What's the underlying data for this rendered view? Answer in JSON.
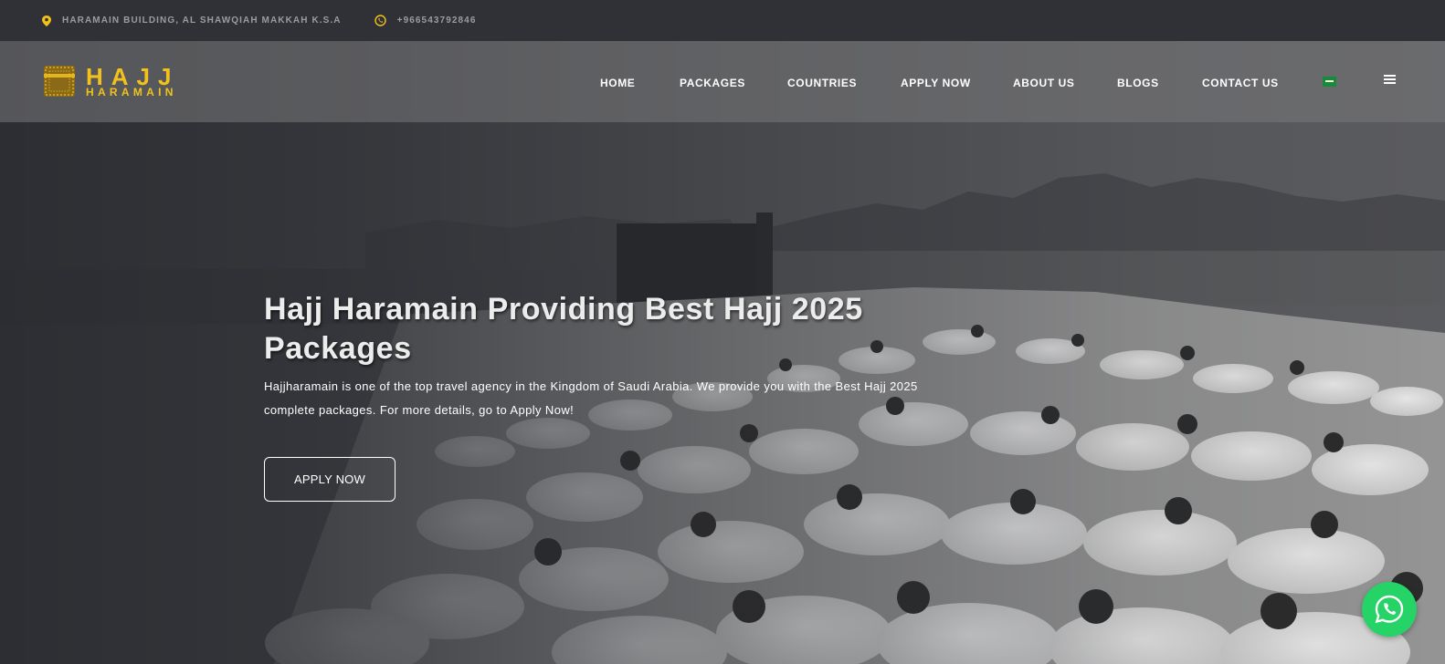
{
  "topbar": {
    "address": "HARAMAIN BUILDING, AL SHAWQIAH MAKKAH K.S.A",
    "phone": "+966543792846",
    "icon_address": "map-pin-icon",
    "icon_phone": "whatsapp-icon"
  },
  "brand": {
    "line1": "HAJJ",
    "line2": "HARAMAIN",
    "color": "#f2c21b"
  },
  "nav": {
    "items": [
      {
        "label": "HOME"
      },
      {
        "label": "PACKAGES"
      },
      {
        "label": "COUNTRIES"
      },
      {
        "label": "APPLY NOW"
      },
      {
        "label": "ABOUT US"
      },
      {
        "label": "BLOGS"
      },
      {
        "label": "CONTACT US"
      }
    ],
    "language_icon": "saudi-flag-icon",
    "menu_icon": "hamburger-icon"
  },
  "hero": {
    "headline": "Hajj Haramain Providing Best Hajj 2025 Packages",
    "description": "Hajjharamain is one of the top travel agency in the Kingdom of Saudi Arabia. We provide you with the Best Hajj 2025 complete packages. For more details, go to Apply Now!",
    "cta_label": "APPLY NOW"
  },
  "floating": {
    "icon": "whatsapp-icon",
    "color": "#25d366"
  }
}
